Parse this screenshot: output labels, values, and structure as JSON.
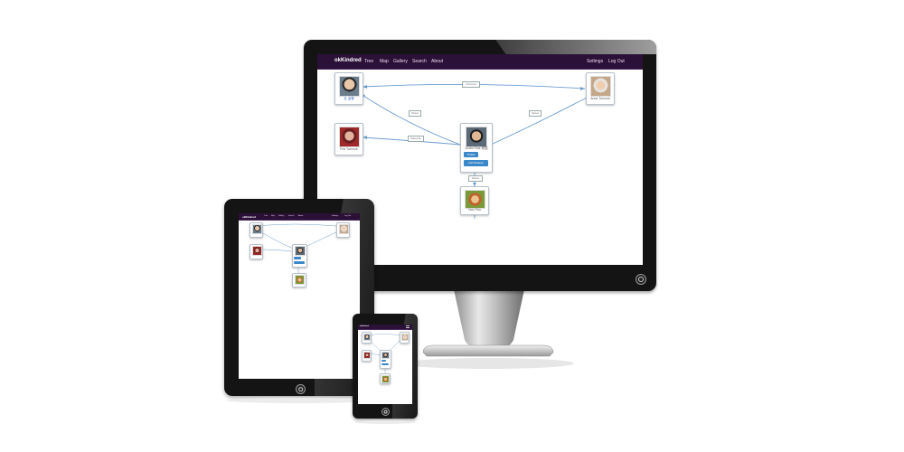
{
  "app": {
    "brand": "okKindred",
    "nav": [
      "Tree",
      "Map",
      "Gallery",
      "Search",
      "About"
    ],
    "nav_right": [
      "Settings",
      "Log Out"
    ]
  },
  "tree": {
    "nodes": [
      {
        "id": "grandfather",
        "caption": "名 迎雪"
      },
      {
        "id": "grandmother",
        "caption": "Anne Turnock"
      },
      {
        "id": "aunt",
        "caption": "Fiot Turnock"
      },
      {
        "id": "self",
        "caption": "Justin Pais 泰国",
        "profile_button": "Profile",
        "add_relation_button": "Add Relation"
      },
      {
        "id": "child",
        "caption": "Nou Pau"
      }
    ],
    "edge_labels": {
      "partnered": "Partnered",
      "raised_left": "Raised",
      "raised_right": "Raised",
      "sibling": "Raised By",
      "raised_child": "Raised"
    }
  },
  "colors": {
    "navbar": "#2b1037",
    "edge": "#6d9ccf",
    "button": "#3a87c9",
    "device_frame": "#141414"
  },
  "icons": {
    "power": "power-button-icon"
  }
}
